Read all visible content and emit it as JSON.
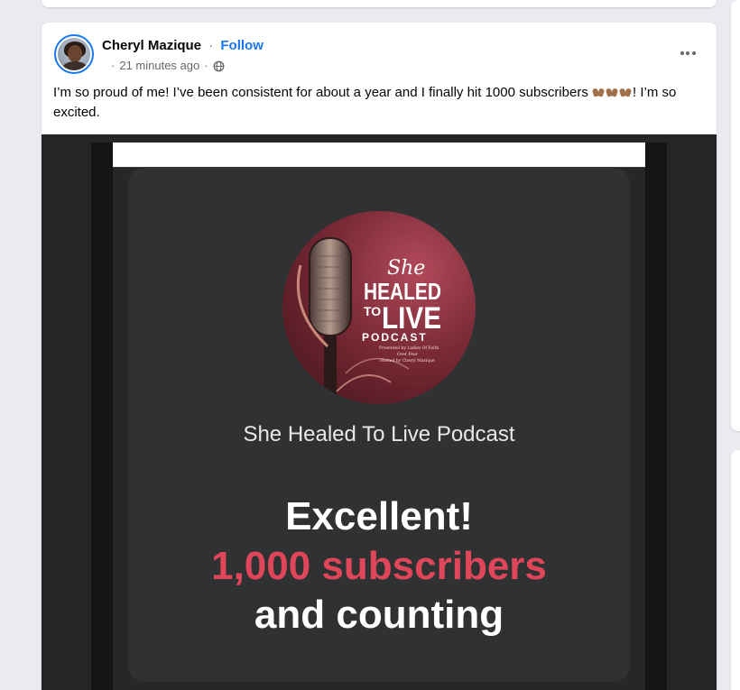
{
  "post": {
    "author": "Cheryl Mazique",
    "separator": "·",
    "follow_label": "Follow",
    "timestamp": "21 minutes ago",
    "meta_dot": "·",
    "audience_icon": "globe-icon",
    "more_icon": "more-options-icon",
    "text_part1": "I’m so proud of me! I’ve been consistent for about a year and I finally hit 1000 subscribers ",
    "text_part2": "! I’m so excited.",
    "emoji": "raising-hands-emoji"
  },
  "media": {
    "artwork": {
      "line1": "She",
      "line2": "HEALED",
      "line3": "TO",
      "line4": "LIVE",
      "line5": "PODCAST",
      "credit1": "Presented by Ladies Of Faith",
      "credit2": "Over Fear",
      "credit3": "Hosted by Cheryl Mazique"
    },
    "podcast_name": "She Healed To Live Podcast",
    "headline_1": "Excellent!",
    "headline_2": "1,000 subscribers",
    "headline_3": "and counting"
  },
  "colors": {
    "accent": "#1877f2",
    "highlight": "#e0465a",
    "media_background": "#242526",
    "card_background": "#303132"
  }
}
